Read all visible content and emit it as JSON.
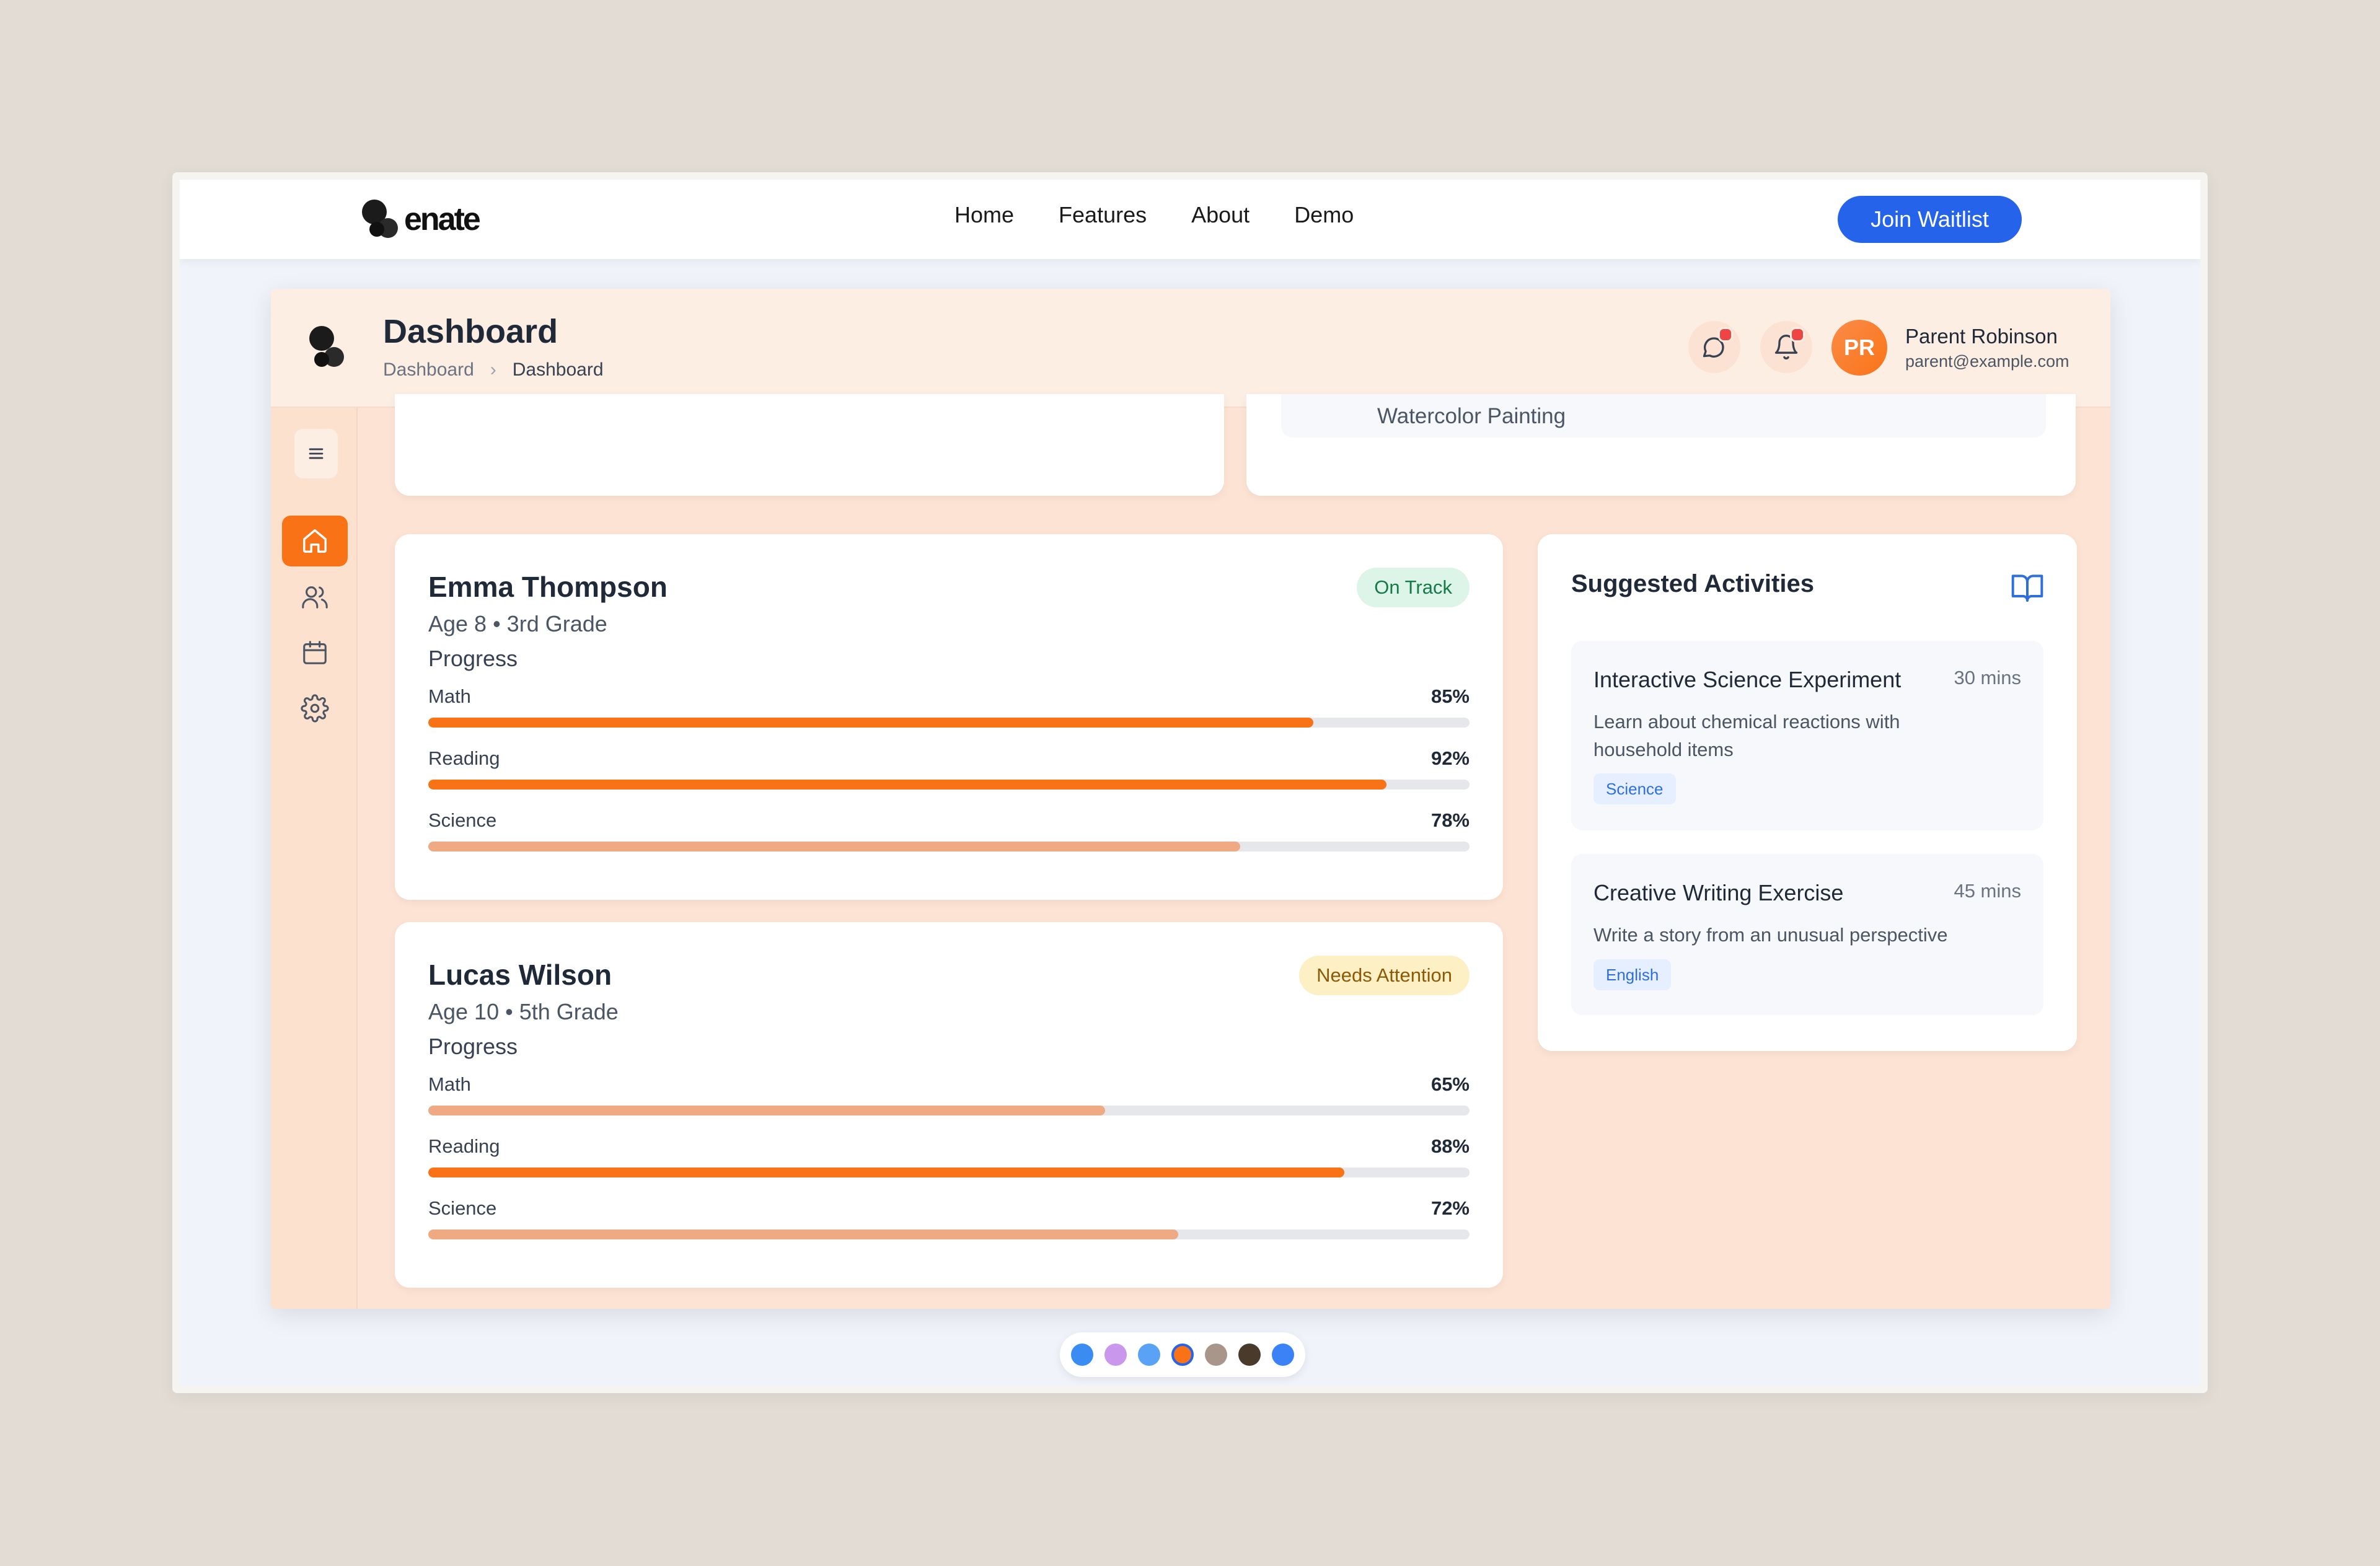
{
  "nav": {
    "brand": "enate",
    "links": [
      "Home",
      "Features",
      "About",
      "Demo"
    ],
    "cta": "Join Waitlist"
  },
  "header": {
    "title": "Dashboard",
    "breadcrumb": [
      "Dashboard",
      "Dashboard"
    ],
    "user": {
      "initials": "PR",
      "name": "Parent Robinson",
      "email": "parent@example.com"
    },
    "icons": [
      "chat-icon",
      "bell-icon"
    ]
  },
  "sidebar": {
    "items": [
      "menu-icon",
      "home-icon",
      "users-icon",
      "calendar-icon",
      "settings-icon"
    ],
    "active": "home-icon"
  },
  "partial_activity": {
    "label": "Watercolor Painting"
  },
  "children": [
    {
      "name": "Emma Thompson",
      "meta": "Age 8 • 3rd Grade",
      "progress_label": "Progress",
      "status": "On Track",
      "subjects": [
        {
          "label": "Math",
          "pct": "85%",
          "value": 0.85,
          "color": "#f97316"
        },
        {
          "label": "Reading",
          "pct": "92%",
          "value": 0.92,
          "color": "#f97316"
        },
        {
          "label": "Science",
          "pct": "78%",
          "value": 0.78,
          "color": "#efa983"
        }
      ]
    },
    {
      "name": "Lucas Wilson",
      "meta": "Age 10 • 5th Grade",
      "progress_label": "Progress",
      "status": "Needs Attention",
      "subjects": [
        {
          "label": "Math",
          "pct": "65%",
          "value": 0.65,
          "color": "#efa983"
        },
        {
          "label": "Reading",
          "pct": "88%",
          "value": 0.88,
          "color": "#f97316"
        },
        {
          "label": "Science",
          "pct": "72%",
          "value": 0.72,
          "color": "#efa983"
        }
      ]
    }
  ],
  "suggested": {
    "title": "Suggested Activities",
    "activities": [
      {
        "title": "Interactive Science Experiment",
        "duration": "30 mins",
        "description": "Learn about chemical reactions with household items",
        "tag": "Science"
      },
      {
        "title": "Creative Writing Exercise",
        "duration": "45 mins",
        "description": "Write a story from an unusual perspective",
        "tag": "English"
      }
    ]
  },
  "theme_colors": [
    "#3b8cf2",
    "#c998ec",
    "#5aa2f6",
    "#f97316",
    "#a8968a",
    "#4a3a2c",
    "#3b82f6"
  ],
  "theme_selected_index": 3,
  "colors": {
    "accent": "#f97316",
    "primary": "#2563eb"
  }
}
